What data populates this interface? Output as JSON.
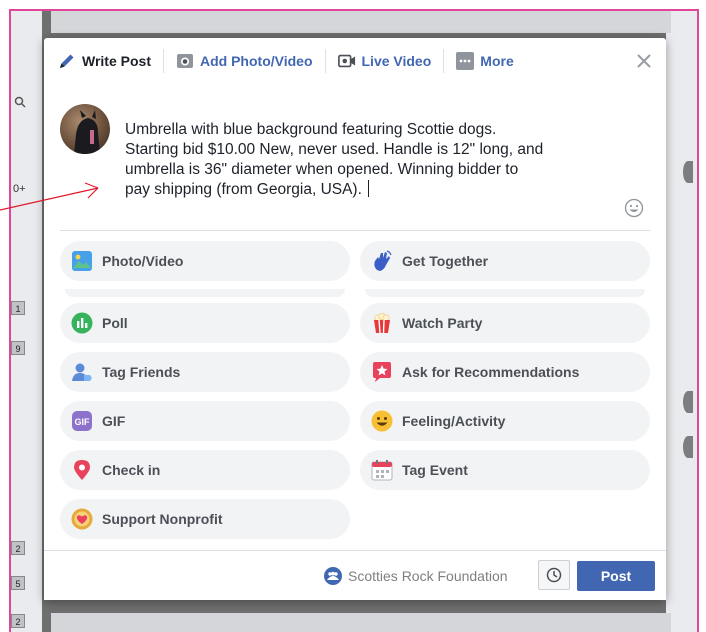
{
  "tabs": [
    {
      "label": "Write Post",
      "icon": "pencil-icon",
      "active": true
    },
    {
      "label": "Add Photo/Video",
      "icon": "camera-icon",
      "active": false
    },
    {
      "label": "Live Video",
      "icon": "video-camera-icon",
      "active": false
    },
    {
      "label": "More",
      "icon": "more-icon",
      "active": false
    }
  ],
  "composer": {
    "lines": [
      "Umbrella with blue background featuring Scottie dogs.",
      "Starting bid $10.00  New, never used. Handle is 12\" long, and",
      "umbrella is 36\" diameter when opened.  Winning bidder to",
      "pay shipping (from Georgia, USA)."
    ]
  },
  "options": {
    "photo_video": "Photo/Video",
    "get_together": "Get Together",
    "poll": "Poll",
    "watch_party": "Watch Party",
    "tag_friends": "Tag Friends",
    "ask_recommendations": "Ask for Recommendations",
    "gif": "GIF",
    "gif_icon_text": "GIF",
    "feeling_activity": "Feeling/Activity",
    "check_in": "Check in",
    "tag_event": "Tag Event",
    "support_nonprofit": "Support Nonprofit"
  },
  "footer": {
    "page_name": "Scotties Rock Foundation",
    "post_label": "Post"
  },
  "background": {
    "side_numbers": [
      "1",
      "9",
      "2",
      "5",
      "2"
    ],
    "left_label": "0+"
  },
  "colors": {
    "accent": "#4267b2",
    "annotation": "#e0192a",
    "frame_border": "#e0479a"
  }
}
